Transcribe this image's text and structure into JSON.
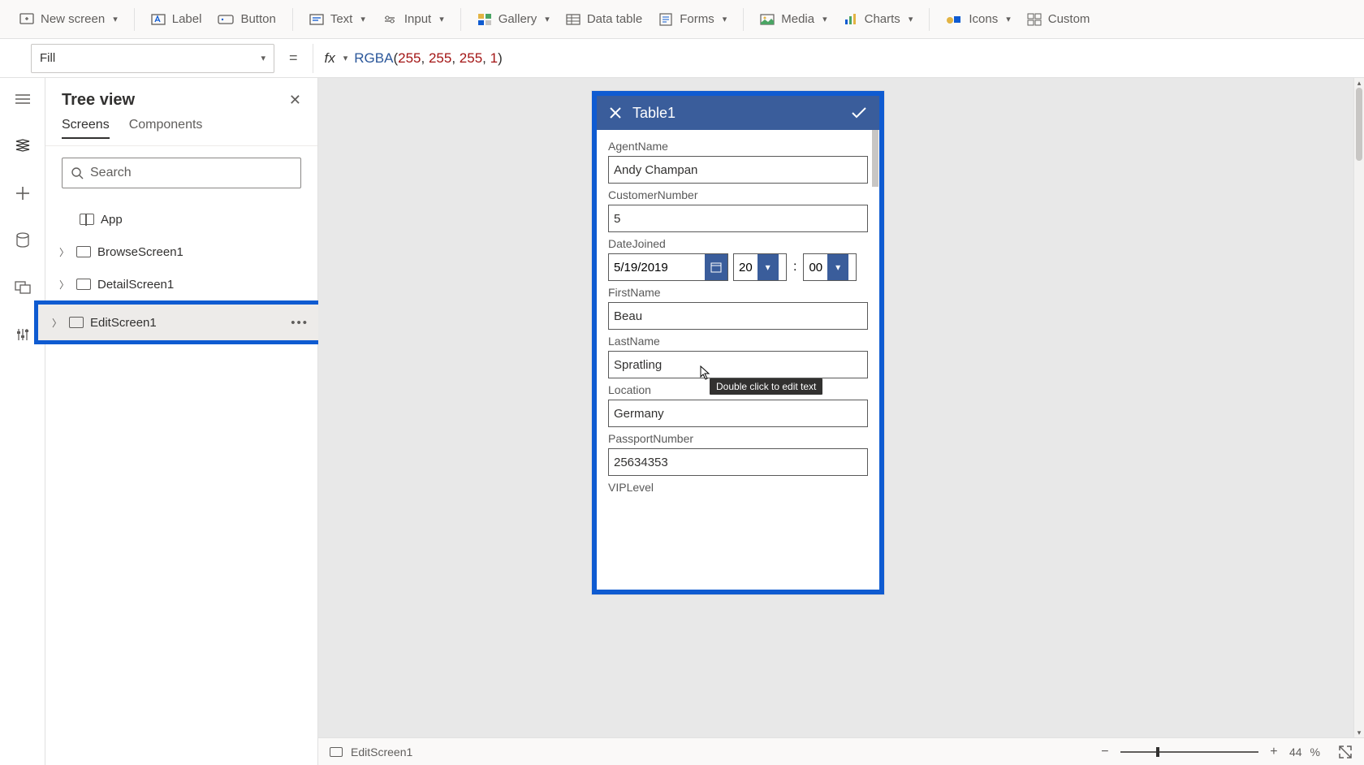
{
  "ribbon": {
    "new_screen": "New screen",
    "label": "Label",
    "button": "Button",
    "text": "Text",
    "input": "Input",
    "gallery": "Gallery",
    "data_table": "Data table",
    "forms": "Forms",
    "media": "Media",
    "charts": "Charts",
    "icons": "Icons",
    "custom": "Custom"
  },
  "property_selector": "Fill",
  "formula": {
    "func": "RGBA",
    "args": [
      "255",
      "255",
      "255",
      "1"
    ]
  },
  "tree": {
    "title": "Tree view",
    "tabs": {
      "screens": "Screens",
      "components": "Components"
    },
    "search_placeholder": "Search",
    "app": "App",
    "items": [
      "BrowseScreen1",
      "DetailScreen1",
      "EditScreen1"
    ]
  },
  "form": {
    "title": "Table1",
    "fields": {
      "agent_name": {
        "label": "AgentName",
        "value": "Andy Champan"
      },
      "customer_number": {
        "label": "CustomerNumber",
        "value": "5"
      },
      "date_joined": {
        "label": "DateJoined",
        "date": "5/19/2019",
        "hour": "20",
        "minute": "00"
      },
      "first_name": {
        "label": "FirstName",
        "value": "Beau"
      },
      "last_name": {
        "label": "LastName",
        "value": "Spratling"
      },
      "location": {
        "label": "Location",
        "value": "Germany"
      },
      "passport_number": {
        "label": "PassportNumber",
        "value": "25634353"
      },
      "vip_level": {
        "label": "VIPLevel"
      }
    }
  },
  "tooltip": "Double click to edit text",
  "statusbar": {
    "screen": "EditScreen1",
    "zoom": "44",
    "pct": "%"
  }
}
